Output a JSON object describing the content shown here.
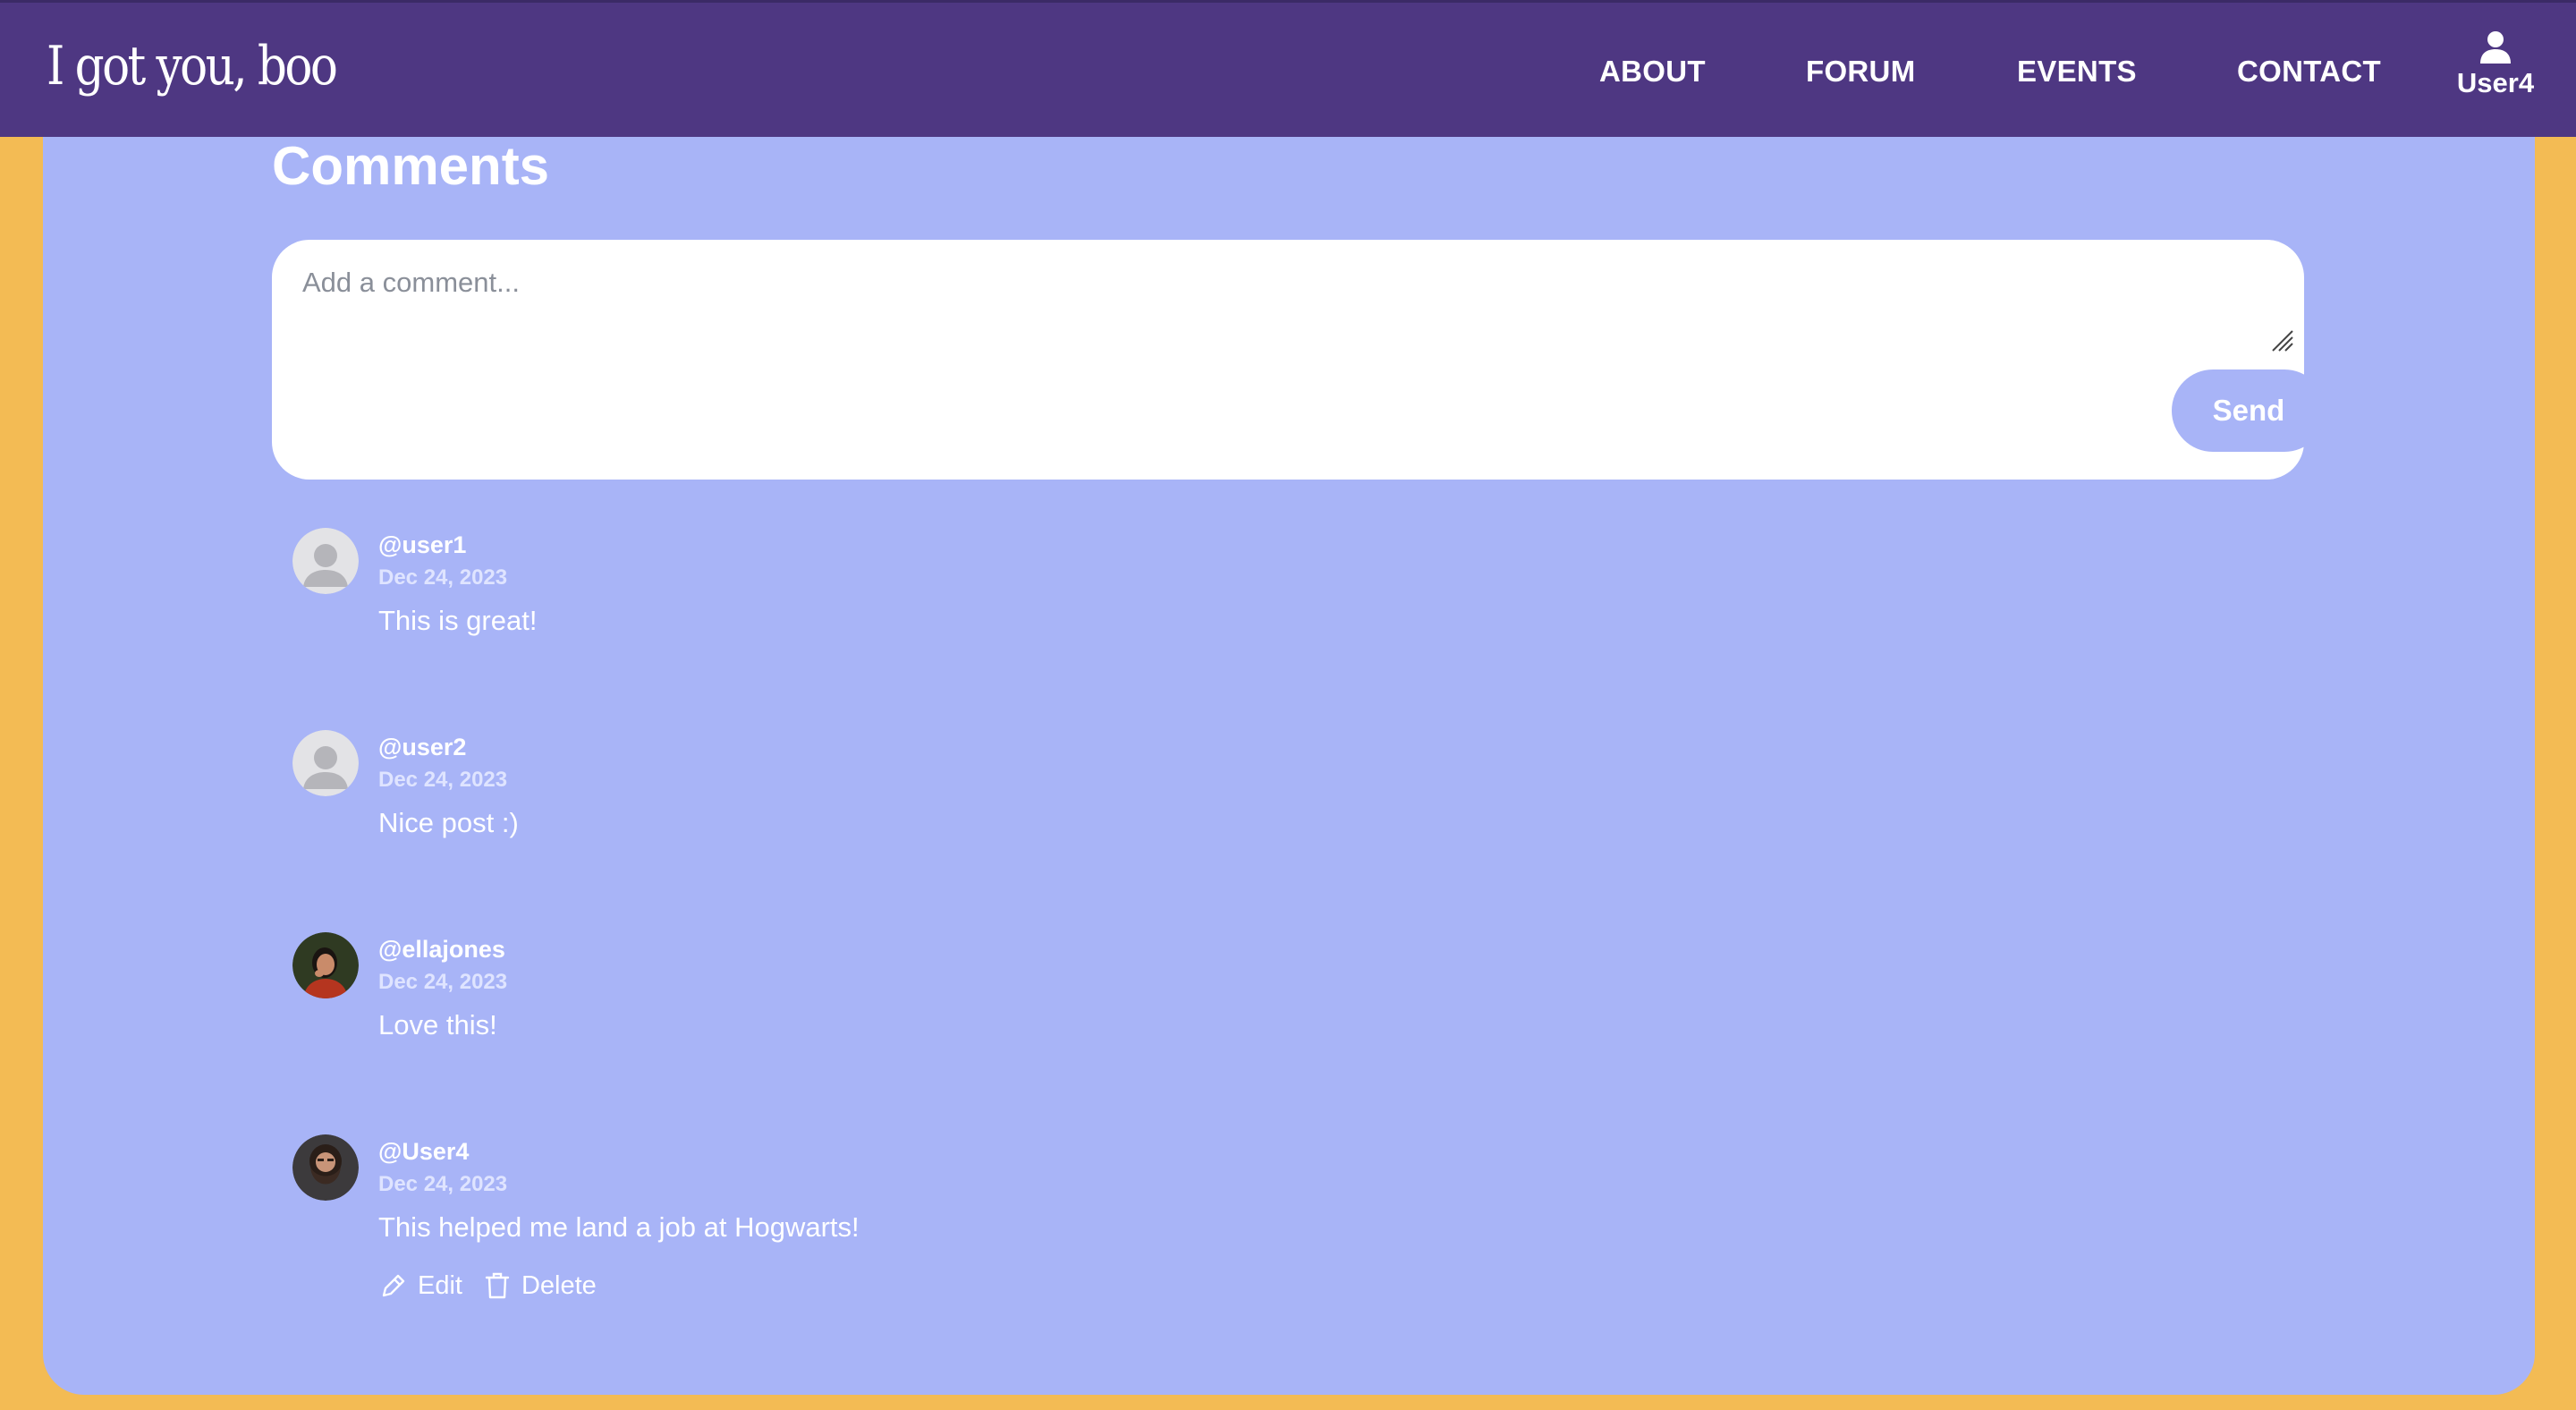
{
  "brand": {
    "logo_text": "I got you, boo"
  },
  "nav": {
    "links": [
      {
        "label": "ABOUT"
      },
      {
        "label": "FORUM"
      },
      {
        "label": "EVENTS"
      },
      {
        "label": "CONTACT"
      }
    ],
    "user": {
      "name": "User4",
      "icon": "user-icon"
    }
  },
  "comments_section": {
    "title": "Comments",
    "input": {
      "placeholder": "Add a comment...",
      "value": ""
    },
    "send_label": "Send"
  },
  "comments": [
    {
      "user": "@user1",
      "date": "Dec 24, 2023",
      "text": "This is great!",
      "avatar": "default-avatar"
    },
    {
      "user": "@user2",
      "date": "Dec 24, 2023",
      "text": "Nice post :)",
      "avatar": "default-avatar"
    },
    {
      "user": "@ellajones",
      "date": "Dec 24, 2023",
      "text": "Love this!",
      "avatar": "photo-avatar"
    },
    {
      "user": "@User4",
      "date": "Dec 24, 2023",
      "text": "This helped me land a job at Hogwarts!",
      "avatar": "photo-avatar",
      "actions": {
        "edit_label": "Edit",
        "delete_label": "Delete"
      }
    }
  ],
  "colors": {
    "nav_bg": "#4e3782",
    "page_bg": "#f3bb54",
    "panel_bg": "#a8b4f7",
    "send_button_bg": "#a8b4f7"
  }
}
